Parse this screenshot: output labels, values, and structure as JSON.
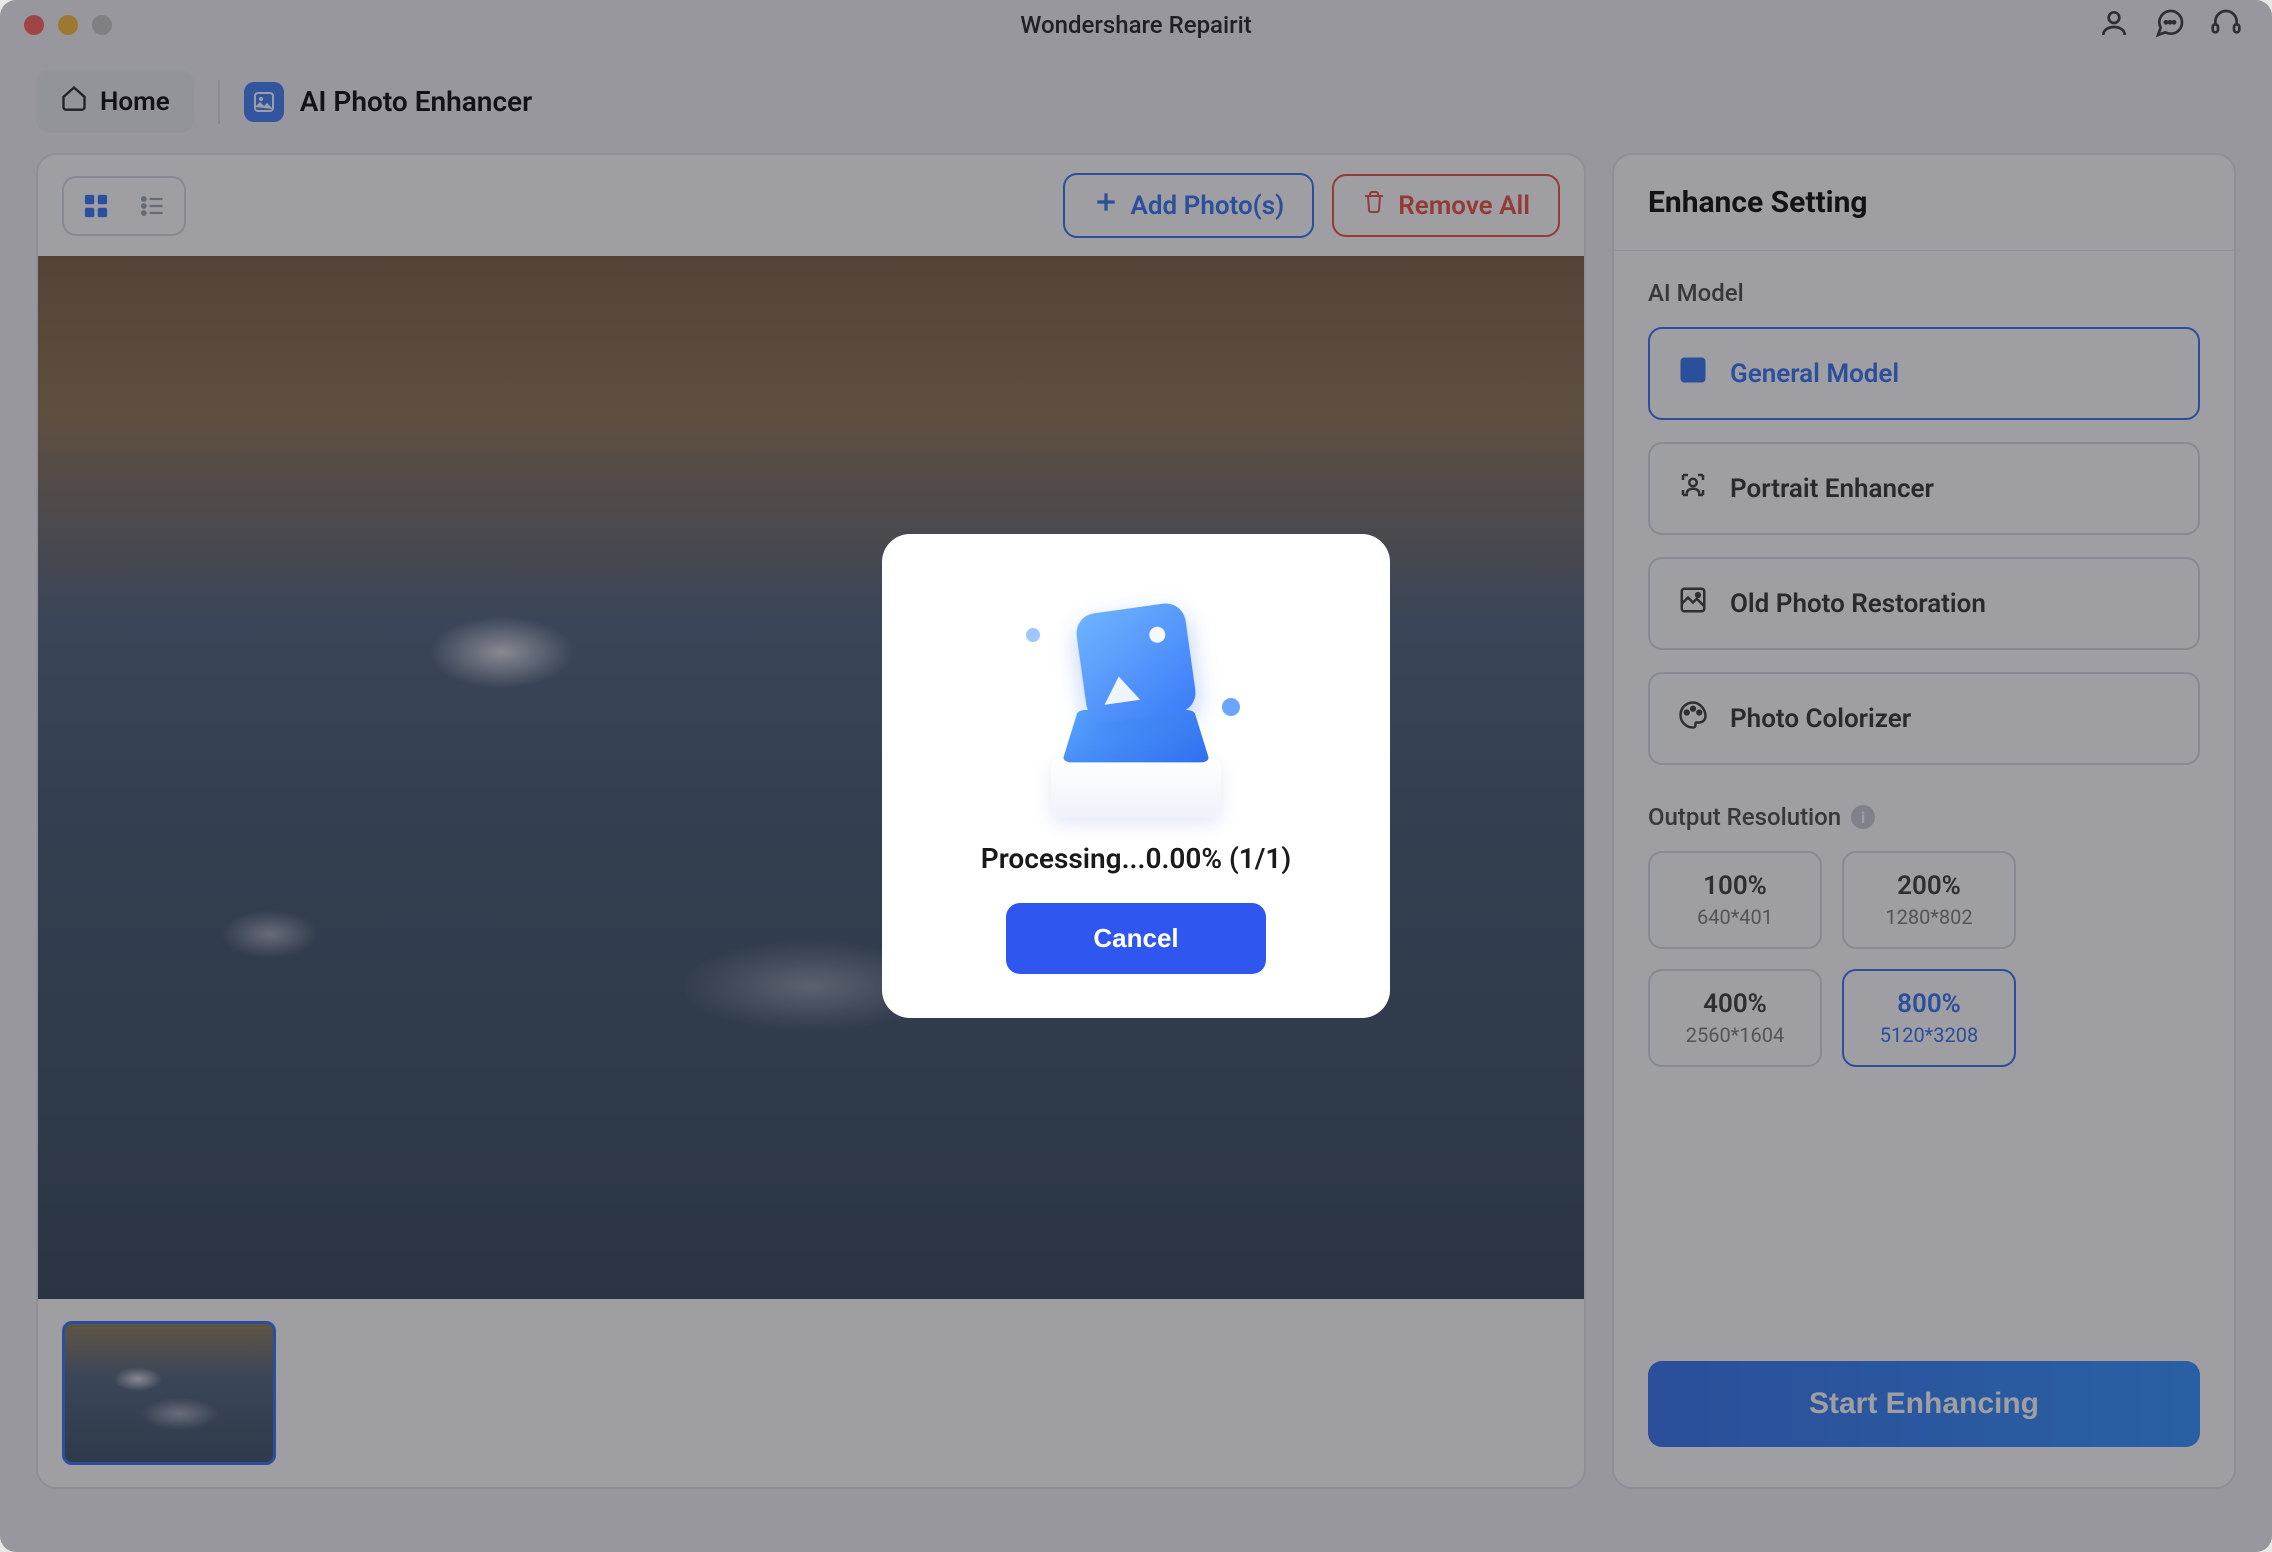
{
  "app_title": "Wondershare Repairit",
  "nav": {
    "home": "Home",
    "feature": "AI Photo Enhancer"
  },
  "toolbar": {
    "add": "Add Photo(s)",
    "remove": "Remove All"
  },
  "panel": {
    "title": "Enhance Setting",
    "ai_model_label": "AI Model",
    "models": {
      "general": "General Model",
      "portrait": "Portrait Enhancer",
      "restoration": "Old Photo Restoration",
      "colorizer": "Photo Colorizer"
    },
    "output_label": "Output Resolution",
    "resolutions": [
      {
        "pct": "100%",
        "dim": "640*401"
      },
      {
        "pct": "200%",
        "dim": "1280*802"
      },
      {
        "pct": "400%",
        "dim": "2560*1604"
      },
      {
        "pct": "800%",
        "dim": "5120*3208"
      }
    ],
    "start": "Start Enhancing"
  },
  "modal": {
    "status": "Processing...0.00% (1/1)",
    "cancel": "Cancel"
  }
}
